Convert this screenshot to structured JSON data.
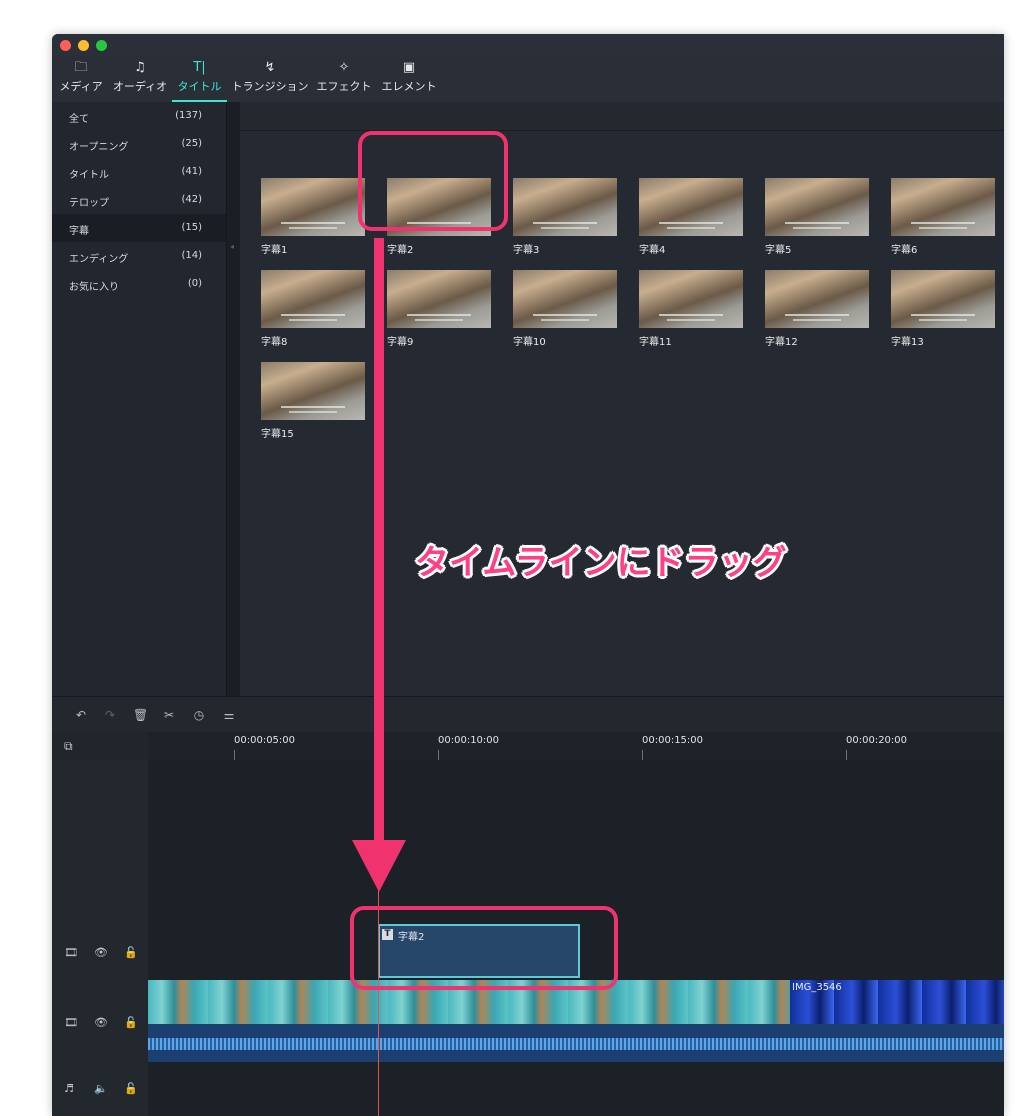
{
  "toolbar": {
    "tabs": [
      {
        "label": "メディア",
        "icon": "folder-icon"
      },
      {
        "label": "オーディオ",
        "icon": "music-note-icon"
      },
      {
        "label": "タイトル",
        "icon": "text-title-icon",
        "active": true
      },
      {
        "label": "トランジション",
        "icon": "transition-icon"
      },
      {
        "label": "エフェクト",
        "icon": "effect-sparkle-icon"
      },
      {
        "label": "エレメント",
        "icon": "image-element-icon"
      }
    ]
  },
  "sidebar": {
    "categories": [
      {
        "name": "全て",
        "count": "(137)"
      },
      {
        "name": "オープニング",
        "count": "(25)"
      },
      {
        "name": "タイトル",
        "count": "(41)"
      },
      {
        "name": "テロップ",
        "count": "(42)"
      },
      {
        "name": "字幕",
        "count": "(15)",
        "selected": true
      },
      {
        "name": "エンディング",
        "count": "(14)"
      },
      {
        "name": "お気に入り",
        "count": "(0)"
      }
    ]
  },
  "thumbnails": [
    {
      "label": "字幕1"
    },
    {
      "label": "字幕2"
    },
    {
      "label": "字幕3"
    },
    {
      "label": "字幕4"
    },
    {
      "label": "字幕5"
    },
    {
      "label": "字幕6"
    },
    {
      "label": "字幕8"
    },
    {
      "label": "字幕9"
    },
    {
      "label": "字幕10"
    },
    {
      "label": "字幕11"
    },
    {
      "label": "字幕12"
    },
    {
      "label": "字幕13"
    },
    {
      "label": "字幕15"
    }
  ],
  "timeline": {
    "ruler": [
      "00:00:05:00",
      "00:00:10:00",
      "00:00:15:00",
      "00:00:20:00"
    ],
    "title_clip": "字幕2",
    "video_clip2_name": "IMG_3546"
  },
  "annotation": {
    "text": "タイムラインにドラッグ",
    "color": "#ff3f86"
  },
  "colors": {
    "accent": "#3ee6d2",
    "highlight": "#f0336f",
    "playhead": "#e8524a"
  }
}
